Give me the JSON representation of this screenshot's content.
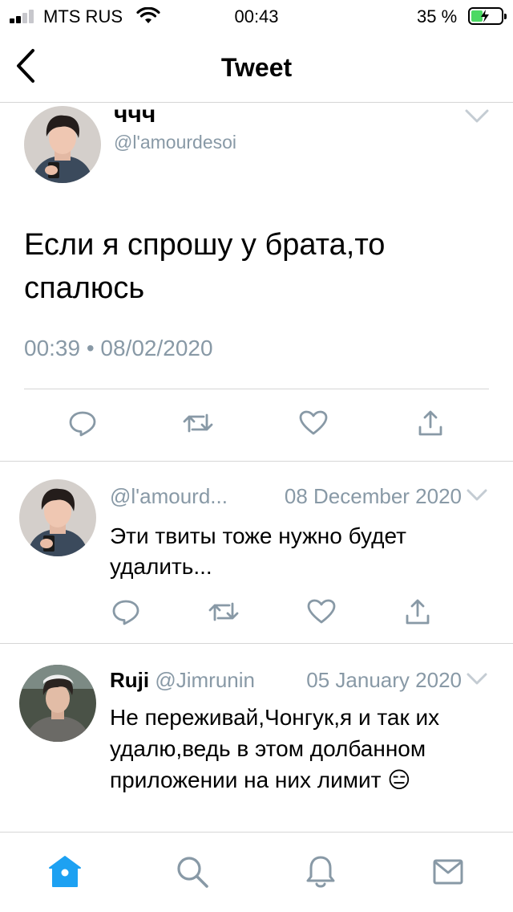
{
  "status_bar": {
    "carrier": "MTS RUS",
    "time": "00:43",
    "battery_percent": "35 %",
    "signal_bars": 2,
    "battery_level": 0.35,
    "battery_color": "#4cd964"
  },
  "nav": {
    "title": "Tweet",
    "back_icon": "chevron-left-icon"
  },
  "main_tweet": {
    "display_name": "ччч",
    "handle": "@l'amourdesoi",
    "text": "Если я спрошу у брата,то спалюсь",
    "timestamp": "00:39 • 08/02/2020",
    "actions": [
      "reply-icon",
      "retweet-icon",
      "like-icon",
      "share-icon"
    ]
  },
  "replies": [
    {
      "name": "",
      "handle": "@l'amourd...",
      "date": "08 December 2020",
      "text": "Эти твиты тоже нужно будет удалить..."
    },
    {
      "name": "Ruji",
      "handle": "@Jimrunin",
      "date": "05 January 2020",
      "text": "Не переживай,Чонгук,я и так их удалю,ведь в этом долбанном приложении на них лимит 😑"
    }
  ],
  "tab_bar": {
    "items": [
      "home-icon",
      "search-icon",
      "notifications-icon",
      "messages-icon"
    ],
    "active": "home-icon",
    "accent": "#1da1f2",
    "inactive_color": "#8899a6"
  },
  "colors": {
    "secondary_text": "#8899a6",
    "divider": "#d6d6d6"
  }
}
